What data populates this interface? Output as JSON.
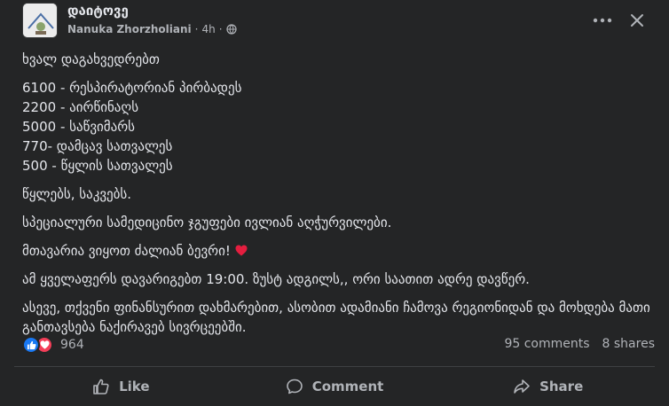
{
  "header": {
    "page_name": "დაიტოვე",
    "author": "Nanuka Zhorzholiani",
    "time": "4h",
    "separator": "·"
  },
  "post": {
    "intro": "ხვალ დაგახვედრებთ",
    "items": [
      "6100 - რესპირატორიან პირბადეს",
      "2200 - აირწინაღს",
      "5000 - საწვიმარს",
      "770- დამცავ სათვალეს",
      "500 - წყლის სათვალეს"
    ],
    "extras": "წყლებს, საკვებს.",
    "medical": "სპეციალური სამედიცინო ჯგუფები ივლიან აღჭურვილები.",
    "main_point": "მთავარია ვიყოთ ძალიან ბევრი!",
    "heart": "❤️",
    "schedule": "ამ ყველაფერს დავარიგებთ 19:00. ზუსტ ადგილს,, ორი საათით ადრე დავწერ.",
    "support": "ასევე, თქვენი ფინანსურით დახმარებით, ასობით ადამიანი ჩამოვა რეგიონიდან და მოხდება მათი განთავსება ნაქირავებ სივრცეებში."
  },
  "reactions": {
    "count": "964",
    "comments": "95 comments",
    "shares": "8 shares"
  },
  "actions": {
    "like": "Like",
    "comment": "Comment",
    "share": "Share"
  },
  "colors": {
    "background": "#242526",
    "text": "#e4e6eb",
    "secondary": "#b0b3b8",
    "like_blue": "#1877f2",
    "love_red": "#f33e58"
  }
}
